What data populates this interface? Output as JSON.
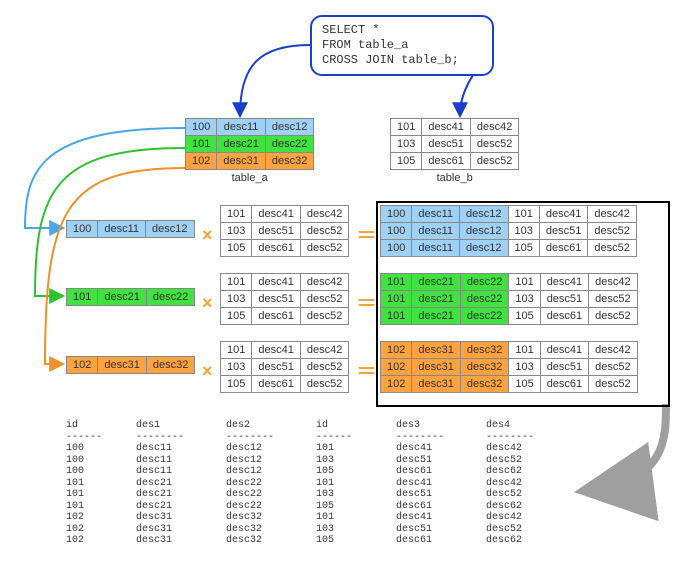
{
  "sql": {
    "line1": "SELECT *",
    "line2": "FROM table_a",
    "line3": "CROSS JOIN table_b;"
  },
  "table_a": {
    "caption": "table_a",
    "rows": [
      {
        "id": "100",
        "c1": "desc11",
        "c2": "desc12",
        "class": "blue"
      },
      {
        "id": "101",
        "c1": "desc21",
        "c2": "desc22",
        "class": "green"
      },
      {
        "id": "102",
        "c1": "desc31",
        "c2": "desc32",
        "class": "orange"
      }
    ]
  },
  "table_b": {
    "caption": "table_b",
    "rows": [
      {
        "id": "101",
        "c1": "desc41",
        "c2": "desc42"
      },
      {
        "id": "103",
        "c1": "desc51",
        "c2": "desc52"
      },
      {
        "id": "105",
        "c1": "desc61",
        "c2": "desc52"
      }
    ]
  },
  "left_rows": [
    {
      "id": "100",
      "c1": "desc11",
      "c2": "desc12",
      "class": "blue"
    },
    {
      "id": "101",
      "c1": "desc21",
      "c2": "desc22",
      "class": "green"
    },
    {
      "id": "102",
      "c1": "desc31",
      "c2": "desc32",
      "class": "orange"
    }
  ],
  "mid_b_rows": [
    {
      "id": "101",
      "c1": "desc41",
      "c2": "desc42"
    },
    {
      "id": "103",
      "c1": "desc51",
      "c2": "desc52"
    },
    {
      "id": "105",
      "c1": "desc61",
      "c2": "desc52"
    }
  ],
  "combos": [
    {
      "class": "blue",
      "rows": [
        {
          "a0": "100",
          "a1": "desc11",
          "a2": "desc12",
          "b0": "101",
          "b1": "desc41",
          "b2": "desc42"
        },
        {
          "a0": "100",
          "a1": "desc11",
          "a2": "desc12",
          "b0": "103",
          "b1": "desc51",
          "b2": "desc52"
        },
        {
          "a0": "100",
          "a1": "desc11",
          "a2": "desc12",
          "b0": "105",
          "b1": "desc61",
          "b2": "desc52"
        }
      ]
    },
    {
      "class": "green",
      "rows": [
        {
          "a0": "101",
          "a1": "desc21",
          "a2": "desc22",
          "b0": "101",
          "b1": "desc41",
          "b2": "desc42"
        },
        {
          "a0": "101",
          "a1": "desc21",
          "a2": "desc22",
          "b0": "103",
          "b1": "desc51",
          "b2": "desc52"
        },
        {
          "a0": "101",
          "a1": "desc21",
          "a2": "desc22",
          "b0": "105",
          "b1": "desc61",
          "b2": "desc52"
        }
      ]
    },
    {
      "class": "orange",
      "rows": [
        {
          "a0": "102",
          "a1": "desc31",
          "a2": "desc32",
          "b0": "101",
          "b1": "desc41",
          "b2": "desc42"
        },
        {
          "a0": "102",
          "a1": "desc31",
          "a2": "desc32",
          "b0": "103",
          "b1": "desc51",
          "b2": "desc52"
        },
        {
          "a0": "102",
          "a1": "desc31",
          "a2": "desc32",
          "b0": "105",
          "b1": "desc61",
          "b2": "desc52"
        }
      ]
    }
  ],
  "result": {
    "headers": [
      "id",
      "des1",
      "des2",
      "id",
      "des3",
      "des4"
    ],
    "rows": [
      [
        "100",
        "desc11",
        "desc12",
        "101",
        "desc41",
        "desc42"
      ],
      [
        "100",
        "desc11",
        "desc12",
        "103",
        "desc51",
        "desc52"
      ],
      [
        "100",
        "desc11",
        "desc12",
        "105",
        "desc61",
        "desc62"
      ],
      [
        "101",
        "desc21",
        "desc22",
        "101",
        "desc41",
        "desc42"
      ],
      [
        "101",
        "desc21",
        "desc22",
        "103",
        "desc51",
        "desc52"
      ],
      [
        "101",
        "desc21",
        "desc22",
        "105",
        "desc61",
        "desc62"
      ],
      [
        "102",
        "desc31",
        "desc32",
        "101",
        "desc41",
        "desc42"
      ],
      [
        "102",
        "desc31",
        "desc32",
        "103",
        "desc51",
        "desc52"
      ],
      [
        "102",
        "desc31",
        "desc32",
        "105",
        "desc61",
        "desc62"
      ]
    ]
  },
  "ops": {
    "times": "×",
    "equals": "="
  }
}
